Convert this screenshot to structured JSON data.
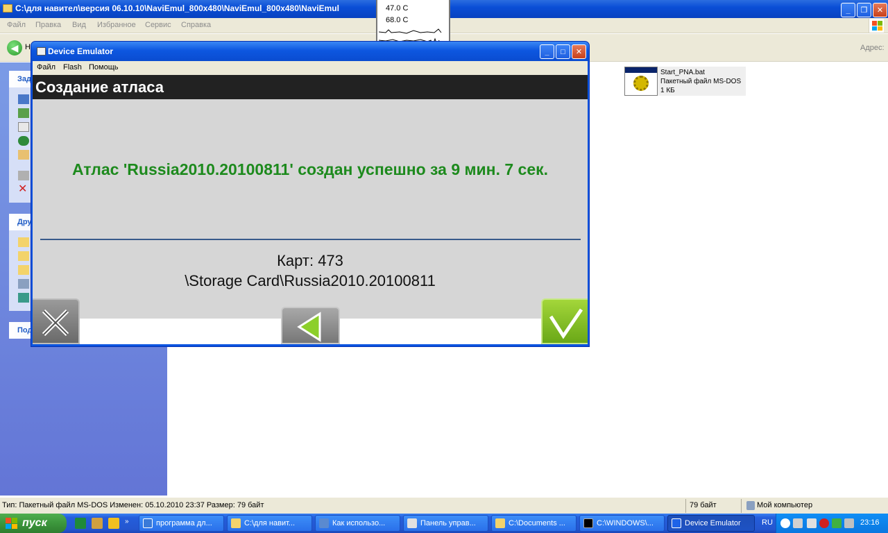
{
  "explorer": {
    "title": "C:\\для навител\\версия 06.10.10\\NaviEmul_800x480\\NaviEmul_800x480\\NaviEmul",
    "menu": [
      "Файл",
      "Правка",
      "Вид",
      "Избранное",
      "Сервис",
      "Справка"
    ],
    "toolbar": {
      "back_label": "Н",
      "address_label": "Адрес:"
    },
    "tasks": {
      "box1_header": "Зад",
      "box2_header": "Дру",
      "box3_header": "Под"
    },
    "file": {
      "name": "Start_PNA.bat",
      "type": "Пакетный файл MS-DOS",
      "size": "1 КБ"
    },
    "status": {
      "info": "Тип: Пакетный файл MS-DOS Изменен: 05.10.2010 23:37 Размер: 79 байт",
      "size": "79 байт",
      "location": "Мой компьютер"
    }
  },
  "sensor": {
    "temp1": "47.0 C",
    "temp2": "68.0 C"
  },
  "emulator": {
    "title": "Device Emulator",
    "menu": [
      "Файл",
      "Flash",
      "Помощь"
    ],
    "screen": {
      "header": "Создание атласа",
      "message": "Атлас 'Russia2010.20100811' создан успешно за 9 мин. 7 сек.",
      "maps": "Карт: 473",
      "path": "\\Storage Card\\Russia2010.20100811"
    }
  },
  "taskbar": {
    "start_label": "пуск",
    "buttons": [
      "программа дл...",
      "C:\\для навит...",
      "Как использо...",
      "Панель управ...",
      "C:\\Documents ...",
      "C:\\WINDOWS\\...",
      "Device Emulator"
    ],
    "lang": "RU",
    "clock": "23:16"
  },
  "colors": {
    "xp_blue": "#0a4ed6",
    "success_green": "#1d8a1d",
    "ok_green": "#7cb82a"
  }
}
